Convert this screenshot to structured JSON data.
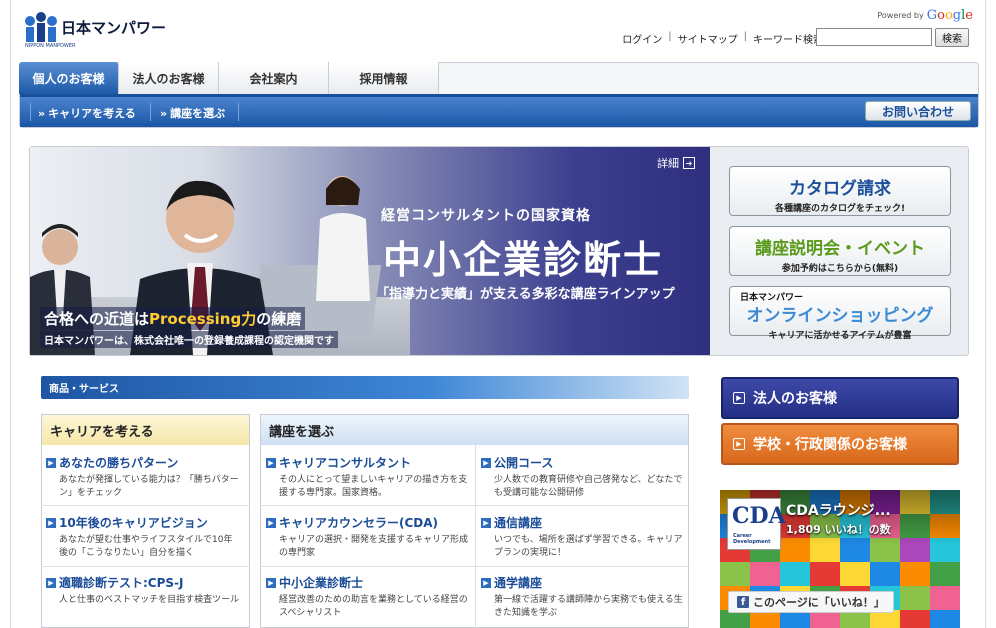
{
  "header": {
    "logo_text": "日本マンパワー",
    "logo_sub": "NIPPON MANPOWER",
    "powered_by": "Powered by",
    "google": "Google",
    "links": [
      "ログイン",
      "サイトマップ",
      "キーワード検索"
    ],
    "search_value": "",
    "search_button": "検索"
  },
  "nav": {
    "tabs": [
      "個人のお客様",
      "法人のお客様",
      "会社案内",
      "採用情報"
    ],
    "active_tab": 0,
    "subnav": [
      "キャリアを考える",
      "講座を選ぶ"
    ],
    "contact_button": "お問い合わせ"
  },
  "hero": {
    "detail": "詳細",
    "subtitle": "経営コンサルタントの国家資格",
    "title": "中小企業診断士",
    "line": "「指導力と実績」が支える多彩な講座ラインアップ",
    "tag_a": "合格への近道は",
    "tag_b": "Processing力",
    "tag_c": "の練磨",
    "foot": "日本マンパワーは、株式会社唯一の登録養成課程の認定機関です"
  },
  "side_buttons": [
    {
      "title": "カタログ請求",
      "sub": "各種講座のカタログをチェック!",
      "color": "#1b4f9a"
    },
    {
      "title": "講座説明会・イベント",
      "sub": "参加予約はこちらから(無料)",
      "color": "#5a9a1a"
    },
    {
      "pre": "日本マンパワー",
      "title_a": "オンライン",
      "title_b": "ショッピング",
      "sub": "キャリアに活かせるアイテムが豊富",
      "color": "#3a8ad6"
    }
  ],
  "products": {
    "bar_label": "商品・サービス",
    "career": {
      "heading": "キャリアを考える",
      "items": [
        {
          "title": "あなたの勝ちパターン",
          "desc": "あなたが発揮している能力は？「勝ちパターン」をチェック"
        },
        {
          "title": "10年後のキャリアビジョン",
          "desc": "あなたが望む仕事やライフスタイルで10年後の「こうなりたい」自分を描く"
        },
        {
          "title": "適職診断テスト:CPS-J",
          "desc": "人と仕事のベストマッチを目指す検査ツール"
        }
      ]
    },
    "courses": {
      "heading": "講座を選ぶ",
      "items": [
        {
          "title": "キャリアコンサルタント",
          "desc": "その人にとって望ましいキャリアの描き方を支援する専門家。国家資格。"
        },
        {
          "title": "公開コース",
          "desc": "少人数での教育研修や自己啓発など、どなたでも受講可能な公開研修"
        },
        {
          "title": "キャリアカウンセラー(CDA)",
          "desc": "キャリアの選択・開発を支援するキャリア形成の専門家"
        },
        {
          "title": "通信講座",
          "desc": "いつでも、場所を選ばず学習できる。キャリアプランの実現に！"
        },
        {
          "title": "中小企業診断士",
          "desc": "経営改善のための助言を業務としている経営のスペシャリスト"
        },
        {
          "title": "通学講座",
          "desc": "第一線で活躍する講師陣から実務でも使える生きた知識を学ぶ"
        }
      ]
    }
  },
  "right": {
    "corp_button": "法人のお客様",
    "corp_color": "#2a3592",
    "school_button": "学校・行政関係のお客様",
    "school_color": "#e0772a"
  },
  "facebook": {
    "logo": "CDA",
    "logo_sub": "Career Development",
    "title": "CDAラウンジ...",
    "likes": "1,809 いいね！の数",
    "like_button": "このページに「いいね！」"
  }
}
